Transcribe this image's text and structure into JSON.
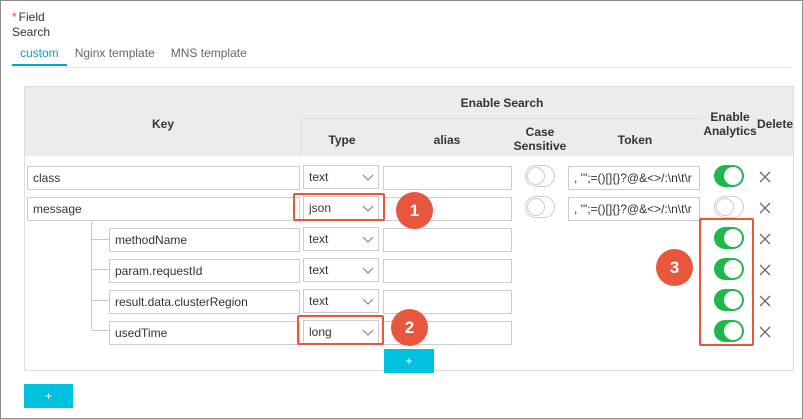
{
  "field": {
    "required_mark": "*",
    "label_line1": "Field",
    "label_line2": "Search"
  },
  "tabs": [
    {
      "label": "custom",
      "active": true
    },
    {
      "label": "Nginx template",
      "active": false
    },
    {
      "label": "MNS template",
      "active": false
    }
  ],
  "table": {
    "headers": {
      "key": "Key",
      "enable_search": "Enable Search",
      "type": "Type",
      "alias": "alias",
      "case_sensitive_1": "Case",
      "case_sensitive_2": "Sensitive",
      "token": "Token",
      "enable_analytics_1": "Enable",
      "enable_analytics_2": "Analytics",
      "delete": "Delete"
    },
    "rows": [
      {
        "key": "class",
        "type": "text",
        "alias": "",
        "case_sensitive": false,
        "token": ", '\";=()[]{}?@&<>/:\\n\\t\\r",
        "analytics": true,
        "child": false
      },
      {
        "key": "message",
        "type": "json",
        "alias": "",
        "case_sensitive": false,
        "token": ", '\";=()[]{}?@&<>/:\\n\\t\\r",
        "analytics": false,
        "child": false
      },
      {
        "key": "methodName",
        "type": "text",
        "alias": "",
        "analytics": true,
        "child": true
      },
      {
        "key": "param.requestId",
        "type": "text",
        "alias": "",
        "analytics": true,
        "child": true
      },
      {
        "key": "result.data.clusterRegion",
        "type": "text",
        "alias": "",
        "analytics": true,
        "child": true
      },
      {
        "key": "usedTime",
        "type": "long",
        "alias": "",
        "analytics": true,
        "child": true
      }
    ],
    "add_child_label": "+"
  },
  "add_button_label": "+",
  "callouts": [
    "1",
    "2",
    "3"
  ],
  "colors": {
    "accent": "#00a3cc",
    "button": "#00c1de",
    "toggle_on": "#1fb84a",
    "highlight": "#e8563d"
  }
}
